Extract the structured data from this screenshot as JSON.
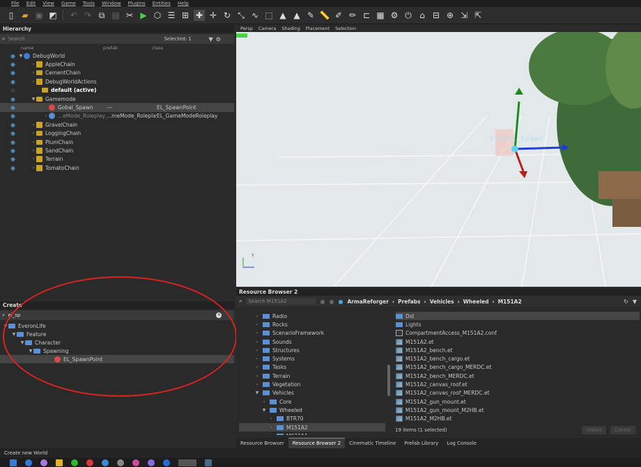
{
  "menu": [
    "File",
    "Edit",
    "View",
    "Game",
    "Tools",
    "Window",
    "Plugins",
    "Entities",
    "Help"
  ],
  "hierarchy": {
    "title": "Hierarchy",
    "search_placeholder": "Search",
    "selected_count": "Selected: 1",
    "col_name": "name",
    "col_prefab": "prefab",
    "col_class": "class",
    "rows": [
      {
        "label": "DebugWorld",
        "prefab": "",
        "class": ""
      },
      {
        "label": "AppleChain",
        "prefab": "",
        "class": ""
      },
      {
        "label": "CementChain",
        "prefab": "",
        "class": ""
      },
      {
        "label": "DebugWorldActions",
        "prefab": "",
        "class": ""
      },
      {
        "label": "default (active)",
        "prefab": "",
        "class": ""
      },
      {
        "label": "Gamemode",
        "prefab": "",
        "class": ""
      },
      {
        "label": "Gobal_Spawn",
        "prefab": "---",
        "class": "EL_SpawnPoint"
      },
      {
        "label": "...eMode_Roleplay_1",
        "prefab": "...meMode_Roleplay",
        "class": "EL_GameModeRoleplay"
      },
      {
        "label": "GravelChain",
        "prefab": "",
        "class": ""
      },
      {
        "label": "LoggingChain",
        "prefab": "",
        "class": ""
      },
      {
        "label": "PlumChain",
        "prefab": "",
        "class": ""
      },
      {
        "label": "SandChain",
        "prefab": "",
        "class": ""
      },
      {
        "label": "Terrain",
        "prefab": "",
        "class": ""
      },
      {
        "label": "TomatoChain",
        "prefab": "",
        "class": ""
      }
    ]
  },
  "create": {
    "title": "Create",
    "search_value": "el_sp",
    "tree": [
      "EveronLife",
      "Feature",
      "Character",
      "Spawning",
      "EL_SpawnPoint"
    ]
  },
  "viewport": {
    "tabs": [
      "Persp",
      "Camera",
      "Shading",
      "Placement",
      "Selection"
    ],
    "label": "Global_Spawn",
    "axis_y": "Y"
  },
  "resource_browser": {
    "title": "Resource Browser 2",
    "search_placeholder": "Search M151A2",
    "path": [
      "ArmaReforger",
      "Prefabs",
      "Vehicles",
      "Wheeled",
      "M151A2"
    ],
    "folders": [
      "Radio",
      "Rocks",
      "ScenarioFramework",
      "Sounds",
      "Structures",
      "Systems",
      "Tasks",
      "Terrain",
      "Vegetation",
      "Vehicles",
      "Core",
      "Wheeled",
      "BTR70",
      "M151A2",
      "M923A1"
    ],
    "files": [
      "Dst",
      "Lights",
      "CompartmentAccess_M151A2.conf",
      "M151A2.et",
      "M151A2_bench.et",
      "M151A2_bench_cargo.et",
      "M151A2_bench_cargo_MERDC.et",
      "M151A2_bench_MERDC.et",
      "M151A2_canvas_roof.et",
      "M151A2_canvas_roof_MERDC.et",
      "M151A2_gun_mount.et",
      "M151A2_gun_mount_M2HB.et",
      "M151A2_M2HB.et"
    ],
    "count": "19 items (1 selected)",
    "import_label": "Import",
    "create_label": "Create"
  },
  "bottom_tabs": [
    "Resource Browser",
    "Resource Browser 2",
    "Cinematic Timeline",
    "Prefab Library",
    "Log Console"
  ],
  "status": "Create new World"
}
